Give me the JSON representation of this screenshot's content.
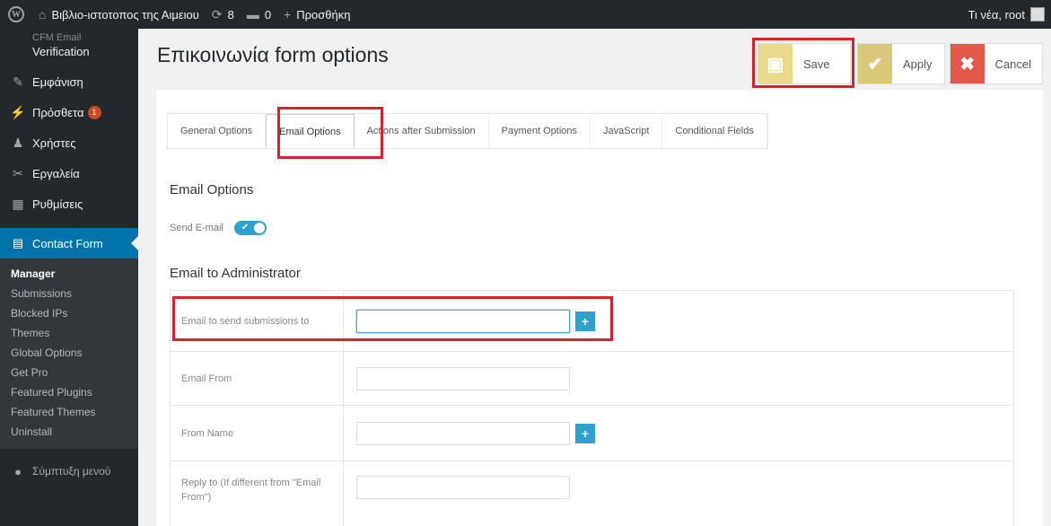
{
  "adminbar": {
    "site_name": "Βιβλιο-ιστοτοπος της Αιμειου",
    "updates_count": "8",
    "comments_count": "0",
    "new_label": "Προσθήκη",
    "greeting": "Τι νέα, root"
  },
  "sidebar": {
    "top_faded": "CFM Email",
    "top_label": "Verification",
    "items": [
      {
        "label": "Εμφάνιση",
        "icon": "brush-icon"
      },
      {
        "label": "Πρόσθετα",
        "icon": "plugin-icon",
        "badge": "1"
      },
      {
        "label": "Χρήστες",
        "icon": "users-icon"
      },
      {
        "label": "Εργαλεία",
        "icon": "wrench-icon"
      },
      {
        "label": "Ρυθμίσεις",
        "icon": "settings-icon"
      }
    ],
    "current": "Contact Form",
    "submenu": [
      "Manager",
      "Submissions",
      "Blocked IPs",
      "Themes",
      "Global Options",
      "Get Pro",
      "Featured Plugins",
      "Featured Themes",
      "Uninstall"
    ],
    "collapse": "Σύμπτυξη μενού"
  },
  "header": {
    "title": "Επικοινωνία form options",
    "save": "Save",
    "apply": "Apply",
    "cancel": "Cancel"
  },
  "tabs": [
    "General Options",
    "Email Options",
    "Actions after Submission",
    "Payment Options",
    "JavaScript",
    "Conditional Fields"
  ],
  "email_options": {
    "heading": "Email Options",
    "send_email_label": "Send E-mail",
    "send_email_on": true
  },
  "admin_section": {
    "heading": "Email to Administrator",
    "rows": [
      {
        "label": "Email to send submissions to",
        "value": "",
        "has_plus": true
      },
      {
        "label": "Email From",
        "value": "",
        "has_plus": false
      },
      {
        "label": "From Name",
        "value": "",
        "has_plus": true
      },
      {
        "label": "Reply to (If different from \"Email From\")",
        "value": "",
        "has_plus": false
      }
    ]
  },
  "colors": {
    "accent": "#2ea2cc",
    "admin_dark": "#23282d",
    "current_menu": "#0073aa",
    "highlight": "#d6212f"
  }
}
